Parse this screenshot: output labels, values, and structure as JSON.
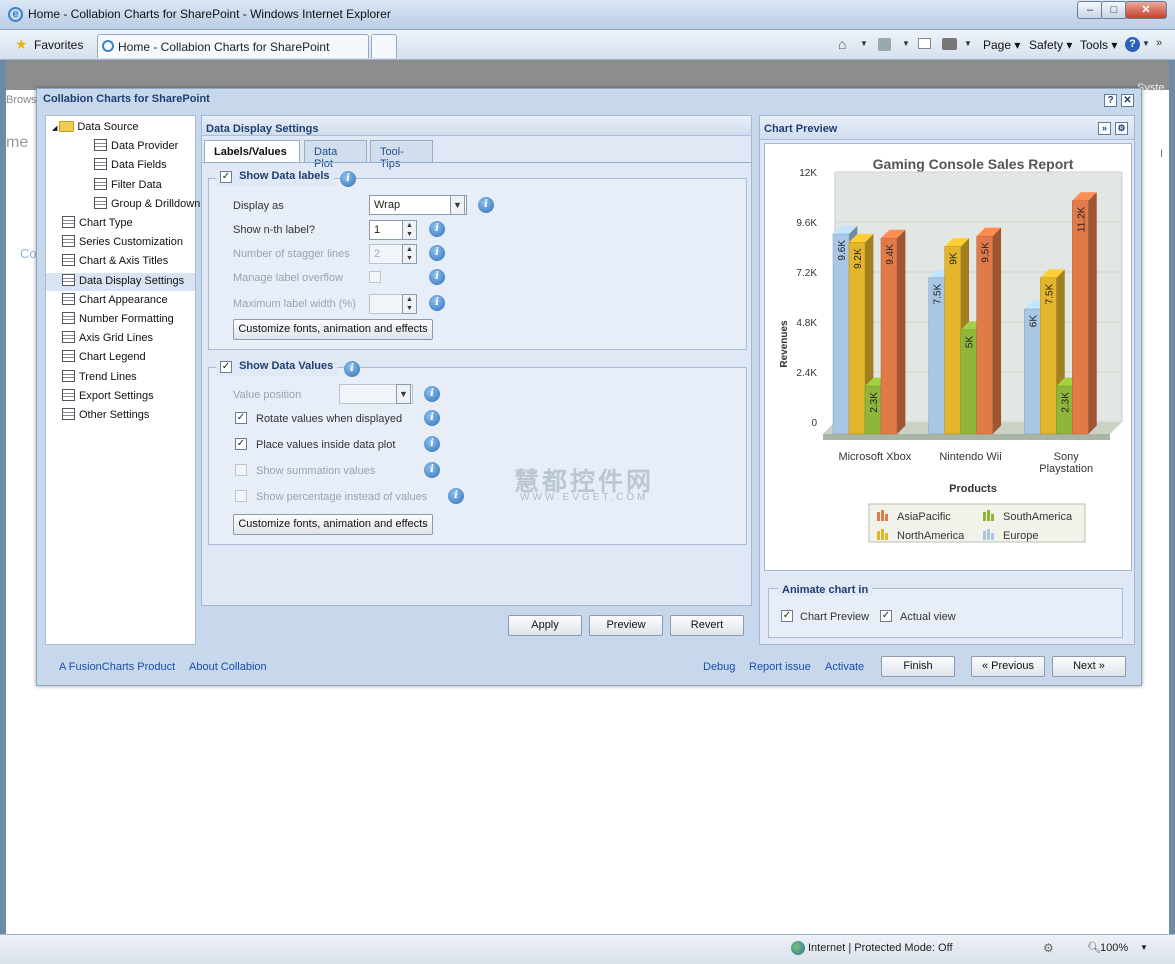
{
  "window": {
    "title": "Home - Collabion Charts for SharePoint - Windows Internet Explorer",
    "minimize": "–",
    "maximize": "□",
    "close": "✕"
  },
  "toolbar": {
    "favorites": "Favorites",
    "tab_title": "Home - Collabion Charts for SharePoint",
    "page": "Page",
    "safety": "Safety",
    "tools": "Tools"
  },
  "background": {
    "browse": "Brows",
    "syst": "Syste",
    "me": "me",
    "co": "Co",
    "i": "I"
  },
  "dialog": {
    "title": "Collabion Charts for SharePoint",
    "help": "?",
    "close": "✕"
  },
  "tree": [
    {
      "label": "Data Source",
      "level": 0,
      "type": "folder"
    },
    {
      "label": "Data Provider",
      "level": 1
    },
    {
      "label": "Data Fields",
      "level": 1
    },
    {
      "label": "Filter Data",
      "level": 1
    },
    {
      "label": "Group & Drilldown",
      "level": 1
    },
    {
      "label": "Chart Type",
      "level": 0
    },
    {
      "label": "Series Customization",
      "level": 0
    },
    {
      "label": "Chart & Axis Titles",
      "level": 0
    },
    {
      "label": "Data Display Settings",
      "level": 0,
      "selected": true
    },
    {
      "label": "Chart Appearance",
      "level": 0
    },
    {
      "label": "Number Formatting",
      "level": 0
    },
    {
      "label": "Axis Grid Lines",
      "level": 0
    },
    {
      "label": "Chart Legend",
      "level": 0
    },
    {
      "label": "Trend Lines",
      "level": 0
    },
    {
      "label": "Export Settings",
      "level": 0
    },
    {
      "label": "Other Settings",
      "level": 0
    }
  ],
  "settings": {
    "header": "Data Display Settings",
    "tabs": [
      "Labels/Values",
      "Data Plot",
      "Tool-Tips"
    ],
    "labels_group": {
      "title": "Show Data labels",
      "checked": true,
      "display_as_label": "Display as",
      "display_as_value": "Wrap",
      "nth_label": "Show n-th label?",
      "nth_value": "1",
      "stagger_label": "Number of stagger lines",
      "stagger_value": "2",
      "overflow_label": "Manage label overflow",
      "maxwidth_label": "Maximum label width (%)",
      "customize": "Customize fonts, animation and effects"
    },
    "values_group": {
      "title": "Show Data Values",
      "checked": true,
      "position_label": "Value position",
      "rotate_label": "Rotate values when displayed",
      "rotate_checked": true,
      "inside_label": "Place values inside data plot",
      "inside_checked": true,
      "summation_label": "Show summation values",
      "percentage_label": "Show percentage instead of values",
      "customize": "Customize fonts, animation and effects"
    },
    "apply": "Apply",
    "preview": "Preview",
    "revert": "Revert"
  },
  "preview": {
    "header": "Chart Preview",
    "animate_title": "Animate chart in",
    "chart_preview": "Chart Preview",
    "actual_view": "Actual view"
  },
  "watermark": {
    "cn": "慧都控件网",
    "url": "WWW.EVGET.COM"
  },
  "footer": {
    "fusion": "A FusionCharts Product",
    "about": "About Collabion",
    "debug": "Debug",
    "report": "Report issue",
    "activate": "Activate",
    "finish": "Finish",
    "previous": "« Previous",
    "next": "Next »"
  },
  "status": {
    "zone": "Internet | Protected Mode: Off",
    "zoom": "100%"
  },
  "colors": {
    "asia": "#e07a48",
    "north": "#e3b52c",
    "south": "#8fb53a",
    "europe": "#a9c6e4"
  },
  "chart_data": {
    "type": "bar",
    "title": "Gaming Console Sales Report",
    "xlabel": "Products",
    "ylabel": "Revenues",
    "categories": [
      "Microsoft Xbox",
      "Nintendo Wii",
      "Sony Playstation"
    ],
    "yticks": [
      "0",
      "2.4K",
      "4.8K",
      "7.2K",
      "9.6K",
      "12K"
    ],
    "ylim": [
      0,
      12000
    ],
    "series": [
      {
        "name": "Europe",
        "color": "#a9c6e4",
        "values": [
          9600,
          7500,
          6000
        ],
        "labels": [
          "9.6K",
          "7.5K",
          "6K"
        ]
      },
      {
        "name": "NorthAmerica",
        "color": "#e3b52c",
        "values": [
          9200,
          9000,
          7500
        ],
        "labels": [
          "9.2K",
          "9K",
          "7.5K"
        ]
      },
      {
        "name": "SouthAmerica",
        "color": "#8fb53a",
        "values": [
          2300,
          5000,
          2300
        ],
        "labels": [
          "2.3K",
          "5K",
          "2.3K"
        ]
      },
      {
        "name": "AsiaPacific",
        "color": "#e07a48",
        "values": [
          9400,
          9500,
          11200
        ],
        "labels": [
          "9.4K",
          "9.5K",
          "11.2K"
        ]
      }
    ],
    "legend_order": [
      "AsiaPacific",
      "SouthAmerica",
      "NorthAmerica",
      "Europe"
    ],
    "legend_position": "bottom"
  }
}
